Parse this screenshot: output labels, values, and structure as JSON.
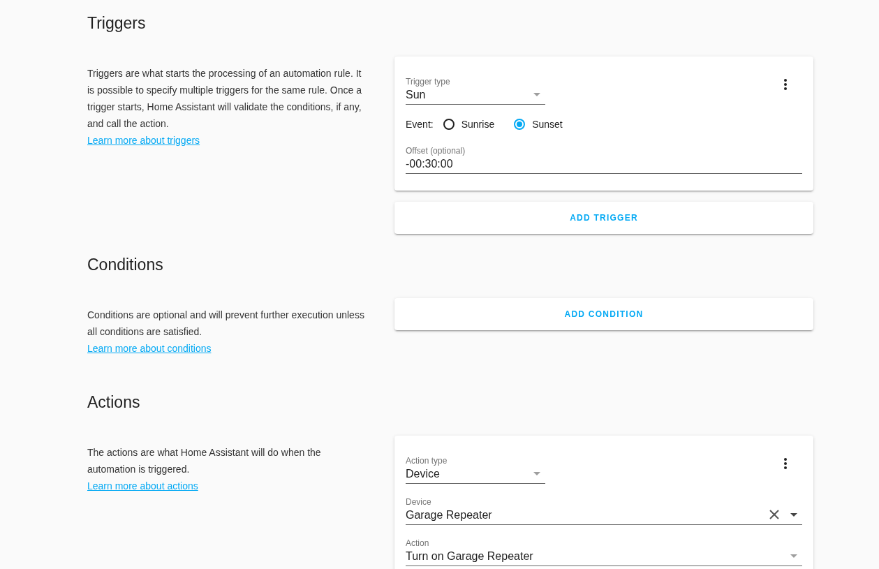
{
  "sections": [
    {
      "title": "Triggers",
      "description": "Triggers are what starts the processing of an automation rule. It is possible to specify multiple triggers for the same rule. Once a trigger starts, Home Assistant will validate the conditions, if any, and call the action.",
      "link": "Learn more about triggers",
      "cards": [
        {
          "fields": [
            {
              "kind": "short_select",
              "label": "Trigger type",
              "value": "Sun"
            },
            {
              "kind": "radio_group",
              "label": "Event:",
              "options": [
                {
                  "label": "Sunrise",
                  "selected": false
                },
                {
                  "label": "Sunset",
                  "selected": true
                }
              ]
            },
            {
              "kind": "text",
              "label": "Offset (optional)",
              "value": "-00:30:00"
            }
          ]
        }
      ],
      "add_button": "ADD TRIGGER"
    },
    {
      "title": "Conditions",
      "description": "Conditions are optional and will prevent further execution unless all conditions are satisfied.",
      "link": "Learn more about conditions",
      "add_button": "ADD CONDITION"
    },
    {
      "title": "Actions",
      "description": "The actions are what Home Assistant will do when the automation is triggered.",
      "link": "Learn more about actions",
      "cards": [
        {
          "fields": [
            {
              "kind": "short_select",
              "label": "Action type",
              "value": "Device"
            },
            {
              "kind": "select",
              "label": "Device",
              "value": "Garage Repeater",
              "clearable": true
            },
            {
              "kind": "select",
              "label": "Action",
              "value": "Turn on Garage Repeater",
              "clearable": false
            }
          ]
        }
      ]
    }
  ]
}
